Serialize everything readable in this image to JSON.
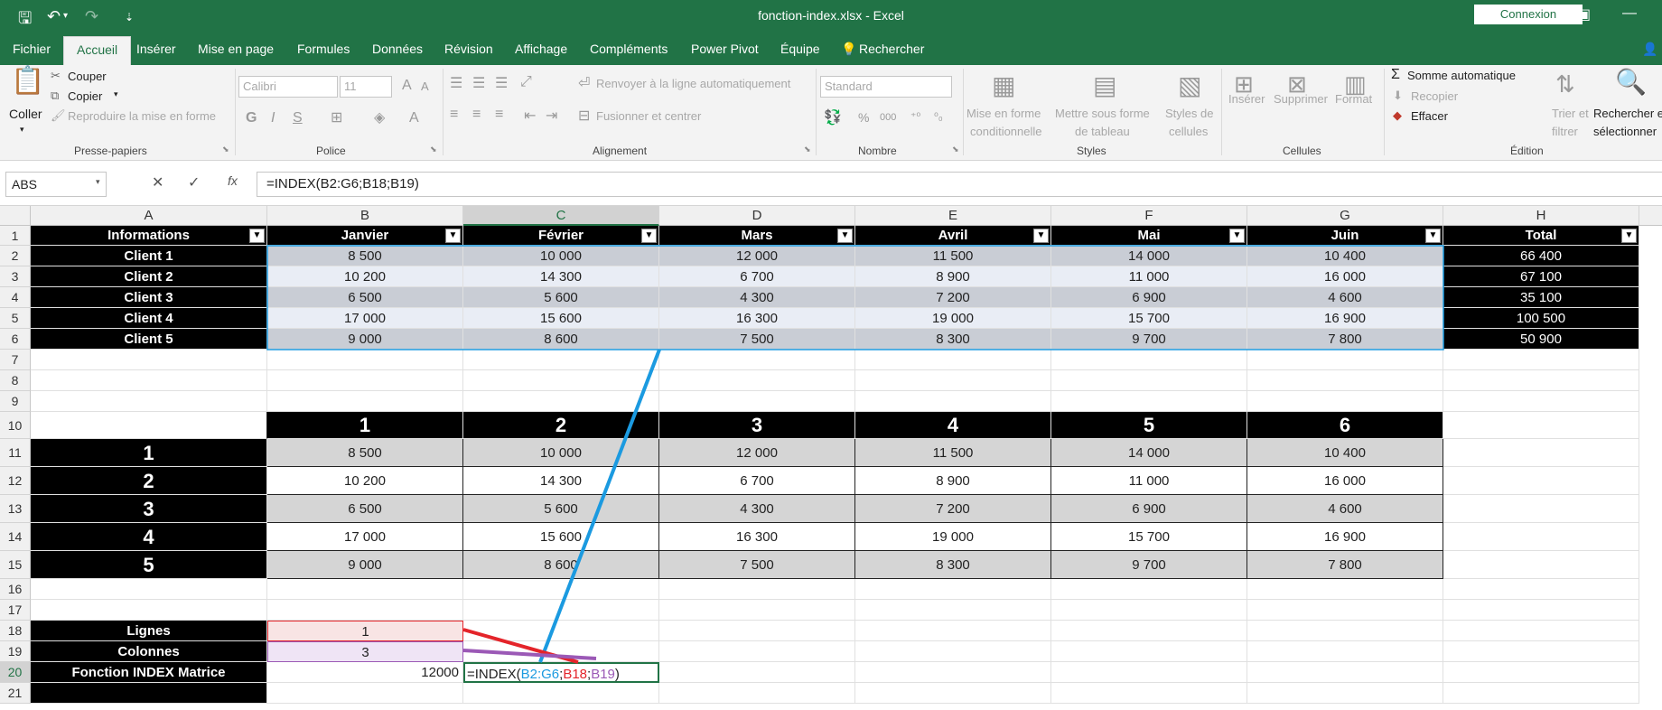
{
  "titlebar": {
    "title": "fonction-index.xlsx  -  Excel",
    "connexion": "Connexion",
    "qa_save": "🖫",
    "qa_undo": "↶",
    "qa_redo": "↷",
    "qa_more": "▾",
    "qa_custom": "⇣"
  },
  "tabs": [
    "Fichier",
    "Accueil",
    "Insérer",
    "Mise en page",
    "Formules",
    "Données",
    "Révision",
    "Affichage",
    "Compléments",
    "Power Pivot",
    "Équipe",
    "Rechercher"
  ],
  "ribbon": {
    "coller": "Coller",
    "couper": "Couper",
    "copier": "Copier",
    "reproduire": "Reproduire la mise en forme",
    "presse": "Presse-papiers",
    "font": "Calibri",
    "size": "11",
    "police": "Police",
    "renvoyer": "Renvoyer à la ligne automatiquement",
    "fusionner": "Fusionner et centrer",
    "alignement": "Alignement",
    "format": "Standard",
    "nombre": "Nombre",
    "percent": "%",
    "thousands": "000",
    "mef1": "Mise en forme",
    "mef2": "conditionnelle",
    "mst1": "Mettre sous forme",
    "mst2": "de tableau",
    "sty1": "Styles de",
    "sty2": "cellules",
    "styles": "Styles",
    "inserer": "Insérer",
    "supprimer": "Supprimer",
    "format_btn": "Format",
    "cellules": "Cellules",
    "somme": "Somme automatique",
    "recopier": "Recopier",
    "effacer": "Effacer",
    "trier1": "Trier et",
    "trier2": "filtrer",
    "rech1": "Rechercher et",
    "rech2": "sélectionner",
    "edition": "Édition"
  },
  "formula_bar": {
    "name_box": "ABS",
    "formula": "=INDEX(B2:G6;B18;B19)",
    "cancel": "✕",
    "enter": "✓",
    "fx": "fx"
  },
  "columns": [
    "A",
    "B",
    "C",
    "D",
    "E",
    "F",
    "G",
    "H"
  ],
  "rows": [
    "1",
    "2",
    "3",
    "4",
    "5",
    "6",
    "7",
    "8",
    "9",
    "10",
    "11",
    "12",
    "13",
    "14",
    "15",
    "16",
    "17",
    "18",
    "19",
    "20",
    "21"
  ],
  "table1": {
    "headers": [
      "Informations",
      "Janvier",
      "Février",
      "Mars",
      "Avril",
      "Mai",
      "Juin",
      "Total"
    ],
    "rows": [
      [
        "Client 1",
        "8 500",
        "10 000",
        "12 000",
        "11 500",
        "14 000",
        "10 400",
        "66 400"
      ],
      [
        "Client 2",
        "10 200",
        "14 300",
        "6 700",
        "8 900",
        "11 000",
        "16 000",
        "67 100"
      ],
      [
        "Client 3",
        "6 500",
        "5 600",
        "4 300",
        "7 200",
        "6 900",
        "4 600",
        "35 100"
      ],
      [
        "Client 4",
        "17 000",
        "15 600",
        "16 300",
        "19 000",
        "15 700",
        "16 900",
        "100 500"
      ],
      [
        "Client 5",
        "9 000",
        "8 600",
        "7 500",
        "8 300",
        "9 700",
        "7 800",
        "50 900"
      ]
    ]
  },
  "table2": {
    "col_indices": [
      "1",
      "2",
      "3",
      "4",
      "5",
      "6"
    ],
    "row_indices": [
      "1",
      "2",
      "3",
      "4",
      "5"
    ],
    "rows": [
      [
        "8 500",
        "10 000",
        "12 000",
        "11 500",
        "14 000",
        "10 400"
      ],
      [
        "10 200",
        "14 300",
        "6 700",
        "8 900",
        "11 000",
        "16 000"
      ],
      [
        "6 500",
        "5 600",
        "4 300",
        "7 200",
        "6 900",
        "4 600"
      ],
      [
        "17 000",
        "15 600",
        "16 300",
        "19 000",
        "15 700",
        "16 900"
      ],
      [
        "9 000",
        "8 600",
        "7 500",
        "8 300",
        "9 700",
        "7 800"
      ]
    ]
  },
  "inputs": {
    "lignes_label": "Lignes",
    "lignes_value": "1",
    "colonnes_label": "Colonnes",
    "colonnes_value": "3",
    "index_label": "Fonction INDEX Matrice",
    "index_result": "12000",
    "edit": {
      "prefix": "=INDEX(",
      "range": "B2:G6",
      "sep1": ";",
      "ref1": "B18",
      "sep2": ";",
      "ref2": "B19",
      "suffix": ")"
    }
  },
  "colors": {
    "excel_green": "#217346",
    "range_blue": "#1b9ae0",
    "ref_red": "#e4242a",
    "ref_purple": "#9b59b6"
  }
}
